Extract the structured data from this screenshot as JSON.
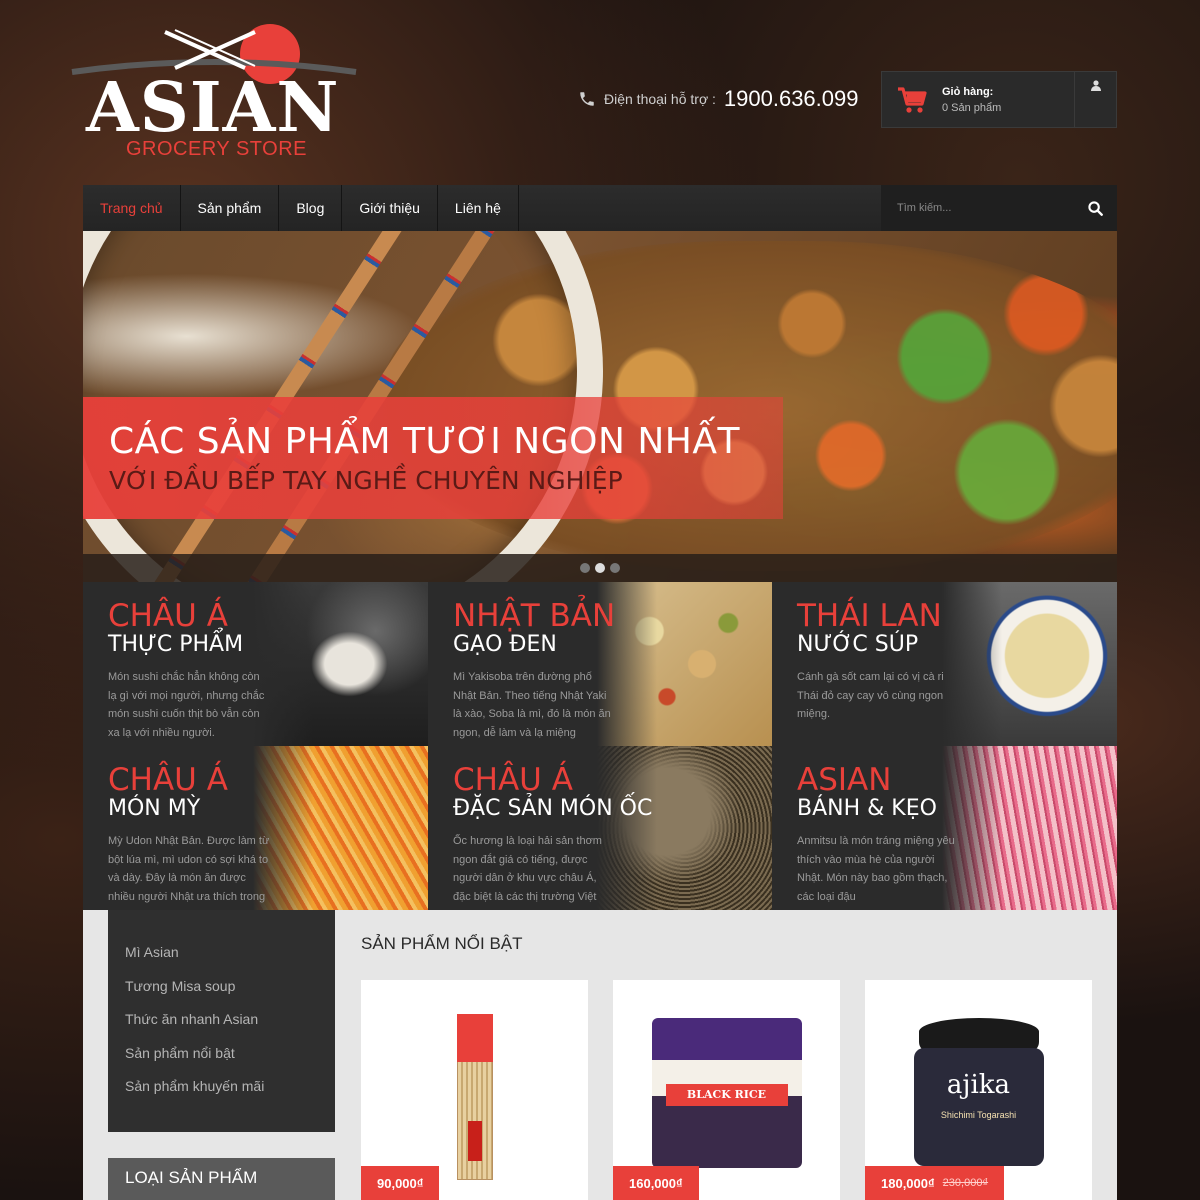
{
  "header": {
    "logo_word": "ASIAN",
    "logo_sub": "GROCERY STORE",
    "phone_label": "Điện thoại hỗ trợ :",
    "phone_number": "1900.636.099",
    "cart_title": "Giỏ hàng:",
    "cart_count": "0 Sản phẩm"
  },
  "nav": {
    "items": [
      {
        "label": "Trang chủ",
        "active": true
      },
      {
        "label": "Sản phẩm"
      },
      {
        "label": "Blog"
      },
      {
        "label": "Giới thiệu"
      },
      {
        "label": "Liên hệ"
      }
    ],
    "search_placeholder": "Tìm kiếm..."
  },
  "hero": {
    "title": "CÁC SẢN PHẨM TƯƠI NGON NHẤT",
    "subtitle": "VỚI ĐẦU BẾP TAY NGHỀ CHUYÊN NGHIỆP",
    "slide_count": 3,
    "active_slide": 2
  },
  "tiles": [
    {
      "title": "CHÂU Á",
      "subtitle": "THỰC PHẨM",
      "desc": "Món sushi chắc hẳn không còn lạ gì với mọi người, nhưng chắc món sushi cuốn thịt bò vẫn còn xa lạ với nhiều người."
    },
    {
      "title": "NHẬT BẢN",
      "subtitle": "GẠO ĐEN",
      "desc": "Mì Yakisoba trên đường phố Nhật Bản. Theo tiếng Nhật Yaki là xào, Soba là mì, đó là món ăn ngon, dễ làm và lạ miệng"
    },
    {
      "title": "THÁI LAN",
      "subtitle": "NƯỚC SÚP",
      "desc": "Cánh gà sốt cam lại có vị cà ri Thái đỏ cay cay vô cùng ngon miệng."
    },
    {
      "title": "CHÂU Á",
      "subtitle": "MÓN MỲ",
      "desc": "Mỳ Udon Nhật Bản. Được làm từ bột lúa mì, mì udon có sợi khá to và dày. Đây là món ăn được nhiều người Nhật ưa thích trong"
    },
    {
      "title": "CHÂU Á",
      "subtitle": "ĐẶC SẢN MÓN ỐC",
      "desc": "Ốc hương là loại hải sản thơm ngon đắt giá có tiếng, được người dân ở khu vực châu Á, đặc biệt là các thị trường Việt"
    },
    {
      "title": "ASIAN",
      "subtitle": "BÁNH & KẸO",
      "desc": "Anmitsu là món tráng miệng yêu thích vào mùa hè của người Nhật. Món này bao gồm thạch, các loại đậu"
    }
  ],
  "sidebar": {
    "links": [
      "Mì Asian",
      "Tương Misa soup",
      "Thức ăn nhanh Asian",
      "Sản phẩm nổi bật",
      "Sản phẩm khuyến mãi"
    ],
    "category_heading": "LOẠI SẢN PHẨM"
  },
  "featured": {
    "title": "SẢN PHẨM NỔI BẬT",
    "products": [
      {
        "image": "chopsticks-pack",
        "price": "90,000₫",
        "old_price": ""
      },
      {
        "image": "black-rice-bag",
        "label": "BLACK RICE",
        "price": "160,000₫",
        "old_price": ""
      },
      {
        "image": "spice-jar",
        "brand": "ajika",
        "name": "Shichimi Togarashi",
        "price": "180,000₫",
        "old_price": "230,000₫"
      }
    ]
  },
  "colors": {
    "accent": "#e8403a",
    "nav_bg": "#2a2a2a",
    "tile_bg": "#2b2b2b",
    "sidebar_bg": "#2f2f2f",
    "bottom_bg": "#e6e6e6"
  },
  "icons": [
    "phone-icon",
    "cart-icon",
    "user-icon",
    "search-icon"
  ]
}
